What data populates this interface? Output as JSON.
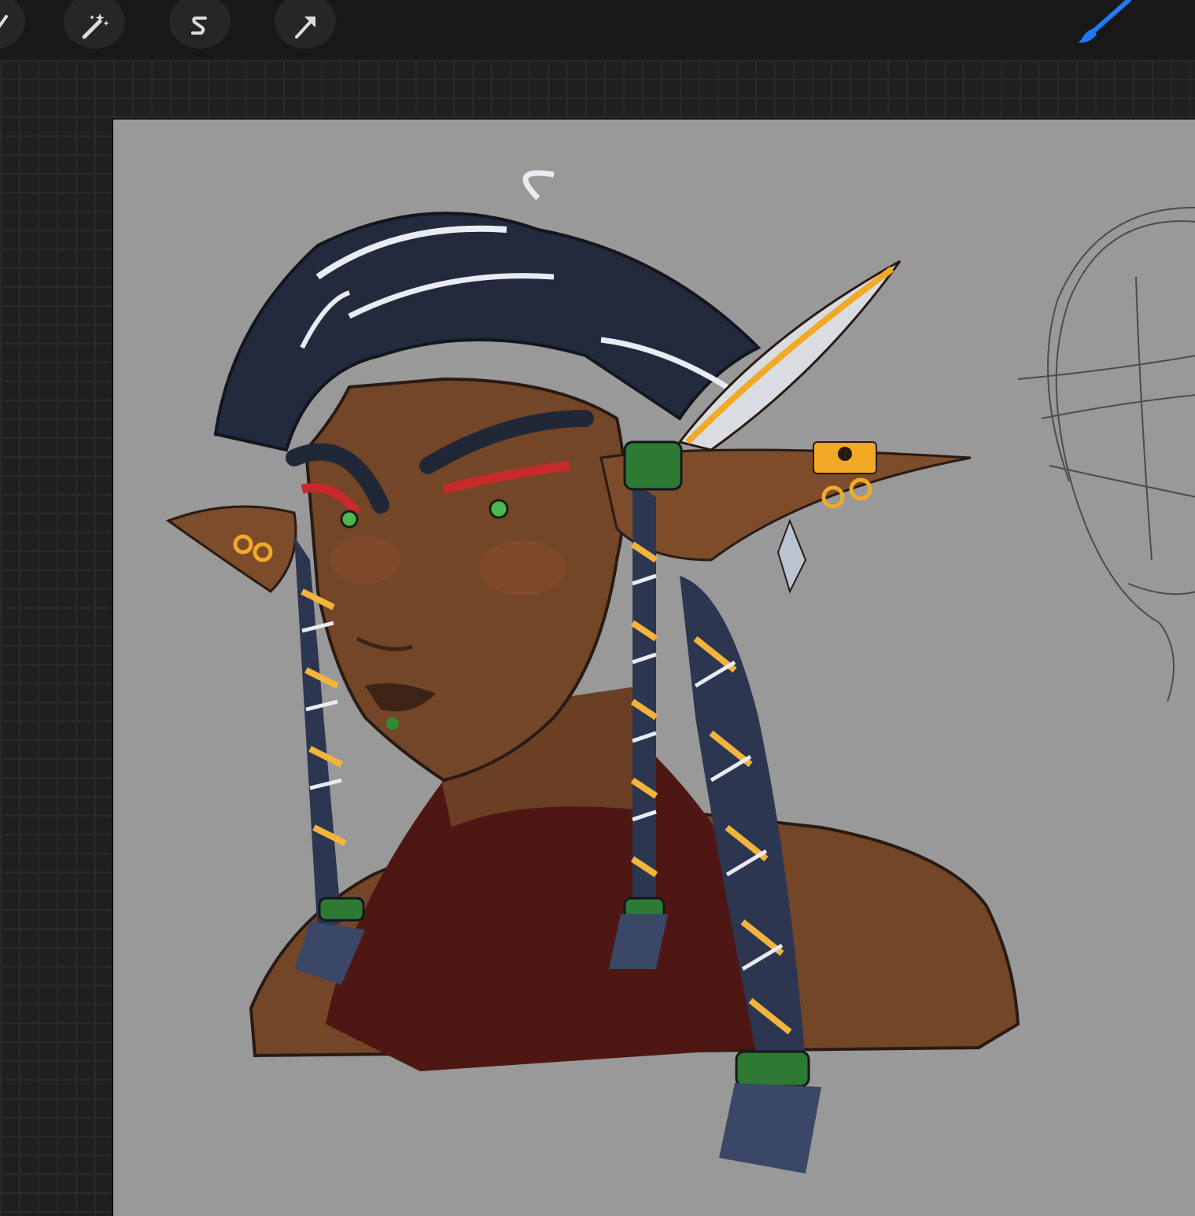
{
  "app": {
    "toolbar": {
      "tools": [
        "selection-tool",
        "adjustments-tool",
        "smudge-selection-tool",
        "transform-tool",
        "brush-tool"
      ],
      "accent_color": "#1f7bf5"
    },
    "canvas": {
      "background_color": "#999999",
      "artwork": "character-portrait",
      "sketch": "head-sketch"
    }
  }
}
